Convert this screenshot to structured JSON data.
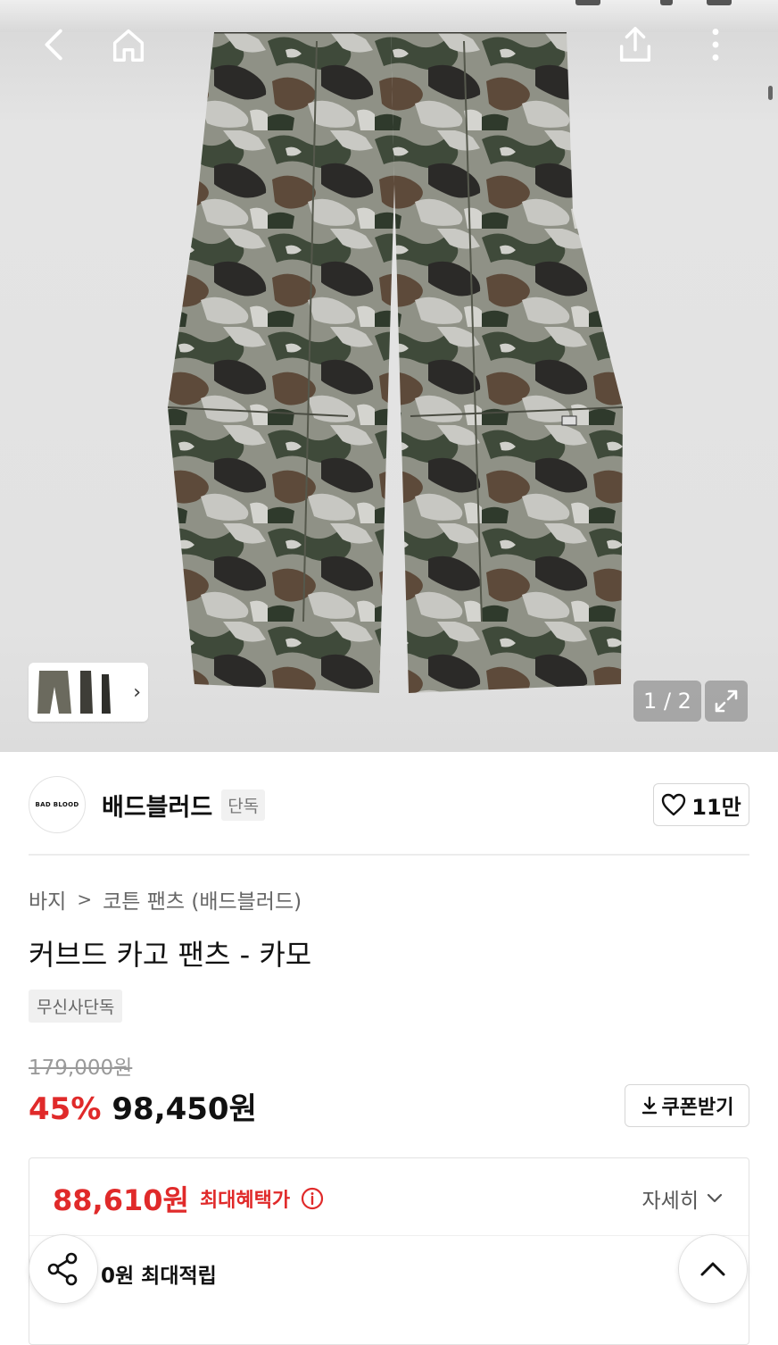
{
  "gallery": {
    "counter": "1 / 2",
    "current_image": 1,
    "total_images": 2
  },
  "brand": {
    "logo_text": "BAD BLOOD",
    "name": "배드블러드",
    "exclusive_tag": "단독",
    "likes": "11만"
  },
  "breadcrumb": {
    "category": "바지",
    "subcategory": "코튼 팬츠 (배드블러드)"
  },
  "product": {
    "title": "커브드 카고 팬츠 - 카모",
    "badge": "무신사단독",
    "original_price": "179,000원",
    "discount": "45%",
    "sale_price": "98,450원",
    "coupon_label": "쿠폰받기"
  },
  "benefit": {
    "max_price": "88,610원",
    "max_label": "최대혜택가",
    "detail_label": "자세히",
    "points": "0원 최대적립"
  },
  "colors": {
    "accent_red": "#e02a2a",
    "text": "#111111",
    "muted": "#666666",
    "border": "#d6d6d6"
  },
  "icons": [
    "back-icon",
    "home-icon",
    "share-upload-icon",
    "more-icon",
    "expand-icon",
    "heart-icon",
    "download-icon",
    "info-icon",
    "chevron-down-icon",
    "share-icon",
    "arrow-up-icon"
  ]
}
